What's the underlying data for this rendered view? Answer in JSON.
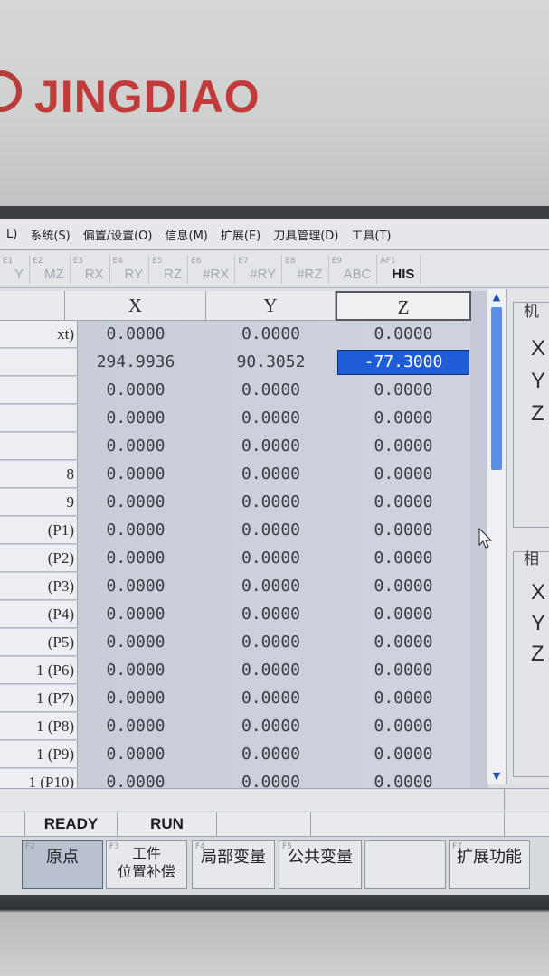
{
  "brand": {
    "name": "JINGDIAO"
  },
  "menubar": [
    {
      "label": "L)"
    },
    {
      "label": "系统(S)"
    },
    {
      "label": "偏置/设置(O)"
    },
    {
      "label": "信息(M)"
    },
    {
      "label": "扩展(E)"
    },
    {
      "label": "刀具管理(D)"
    },
    {
      "label": "工具(T)"
    }
  ],
  "toolbar": [
    {
      "key": "E1",
      "label": "Y",
      "bold": false
    },
    {
      "key": "E2",
      "label": "MZ",
      "bold": false
    },
    {
      "key": "E3",
      "label": "RX",
      "bold": false
    },
    {
      "key": "E4",
      "label": "RY",
      "bold": false
    },
    {
      "key": "E5",
      "label": "RZ",
      "bold": false
    },
    {
      "key": "E6",
      "label": "#RX",
      "bold": false
    },
    {
      "key": "E7",
      "label": "#RY",
      "bold": false
    },
    {
      "key": "E8",
      "label": "#RZ",
      "bold": false
    },
    {
      "key": "E9",
      "label": "ABC",
      "bold": false
    },
    {
      "key": "AF1",
      "label": "HIS",
      "bold": true
    }
  ],
  "table": {
    "columns": [
      "X",
      "Y",
      "Z"
    ],
    "rows": [
      {
        "label": "xt)",
        "x": "0.0000",
        "y": "0.0000",
        "z": "0.0000"
      },
      {
        "label": "",
        "x": "294.9936",
        "y": "90.3052",
        "z": "-77.3000"
      },
      {
        "label": "",
        "x": "0.0000",
        "y": "0.0000",
        "z": "0.0000"
      },
      {
        "label": "",
        "x": "0.0000",
        "y": "0.0000",
        "z": "0.0000"
      },
      {
        "label": "",
        "x": "0.0000",
        "y": "0.0000",
        "z": "0.0000"
      },
      {
        "label": "8",
        "x": "0.0000",
        "y": "0.0000",
        "z": "0.0000"
      },
      {
        "label": "9",
        "x": "0.0000",
        "y": "0.0000",
        "z": "0.0000"
      },
      {
        "label": "(P1)",
        "x": "0.0000",
        "y": "0.0000",
        "z": "0.0000"
      },
      {
        "label": "(P2)",
        "x": "0.0000",
        "y": "0.0000",
        "z": "0.0000"
      },
      {
        "label": "(P3)",
        "x": "0.0000",
        "y": "0.0000",
        "z": "0.0000"
      },
      {
        "label": "(P4)",
        "x": "0.0000",
        "y": "0.0000",
        "z": "0.0000"
      },
      {
        "label": "(P5)",
        "x": "0.0000",
        "y": "0.0000",
        "z": "0.0000"
      },
      {
        "label": "1 (P6)",
        "x": "0.0000",
        "y": "0.0000",
        "z": "0.0000"
      },
      {
        "label": "1 (P7)",
        "x": "0.0000",
        "y": "0.0000",
        "z": "0.0000"
      },
      {
        "label": "1 (P8)",
        "x": "0.0000",
        "y": "0.0000",
        "z": "0.0000"
      },
      {
        "label": "1 (P9)",
        "x": "0.0000",
        "y": "0.0000",
        "z": "0.0000"
      },
      {
        "label": "1 (P10)",
        "x": "0.0000",
        "y": "0.0000",
        "z": "0.0000"
      }
    ],
    "selected": {
      "row": 1,
      "col": "z"
    }
  },
  "side_panel": {
    "machine_title": "机",
    "machine_axes": [
      "X",
      "Y",
      "Z"
    ],
    "relative_title": "相",
    "relative_axes": [
      "X",
      "Y",
      "Z"
    ]
  },
  "status": {
    "state": "READY",
    "mode": "RUN"
  },
  "fkeys": [
    {
      "num": "F2",
      "label": "原点",
      "active": true
    },
    {
      "num": "F3",
      "label": "工件\n位置补偿",
      "active": false
    },
    {
      "num": "F4",
      "label": "局部变量",
      "active": false
    },
    {
      "num": "F5",
      "label": "公共变量",
      "active": false
    },
    {
      "num": "",
      "label": "",
      "active": false
    },
    {
      "num": "F7",
      "label": "扩展功能",
      "active": false
    }
  ]
}
